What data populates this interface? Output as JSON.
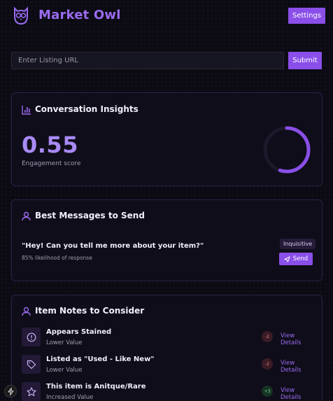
{
  "header": {
    "brand": "Market Owl",
    "settings_label": "Settings"
  },
  "url_bar": {
    "placeholder": "Enter Listing URL",
    "value": "",
    "submit_label": "Submit"
  },
  "insights": {
    "title": "Conversation Insights",
    "score": "0.55",
    "score_value": 0.55,
    "score_label": "Engagement score"
  },
  "messages": {
    "title": "Best Messages to Send",
    "items": [
      {
        "text": "\"Hey! Can you tell me more about your item?\"",
        "likelihood": "85% likelihood of response",
        "tag": "Inquisitive",
        "send_label": "Send"
      }
    ]
  },
  "notes": {
    "title": "Item Notes to Consider",
    "items": [
      {
        "title": "Appears Stained",
        "subtitle": "Lower Value",
        "badge": "-2",
        "link": "View Details",
        "icon": "alert-circle-icon"
      },
      {
        "title": "Listed as \"Used - Like New\"",
        "subtitle": "Lower Value",
        "badge": "-2",
        "link": "View Details",
        "icon": "tag-icon"
      },
      {
        "title": "This item is Anitque/Rare",
        "subtitle": "Increased Value",
        "badge": "+3",
        "link": "View Details",
        "icon": "star-icon"
      }
    ]
  },
  "colors": {
    "accent": "#8a4fe8",
    "brand": "#9b6bf0",
    "score": "#a98af5",
    "negative": "#e98a8a",
    "positive": "#6fe0a0"
  }
}
